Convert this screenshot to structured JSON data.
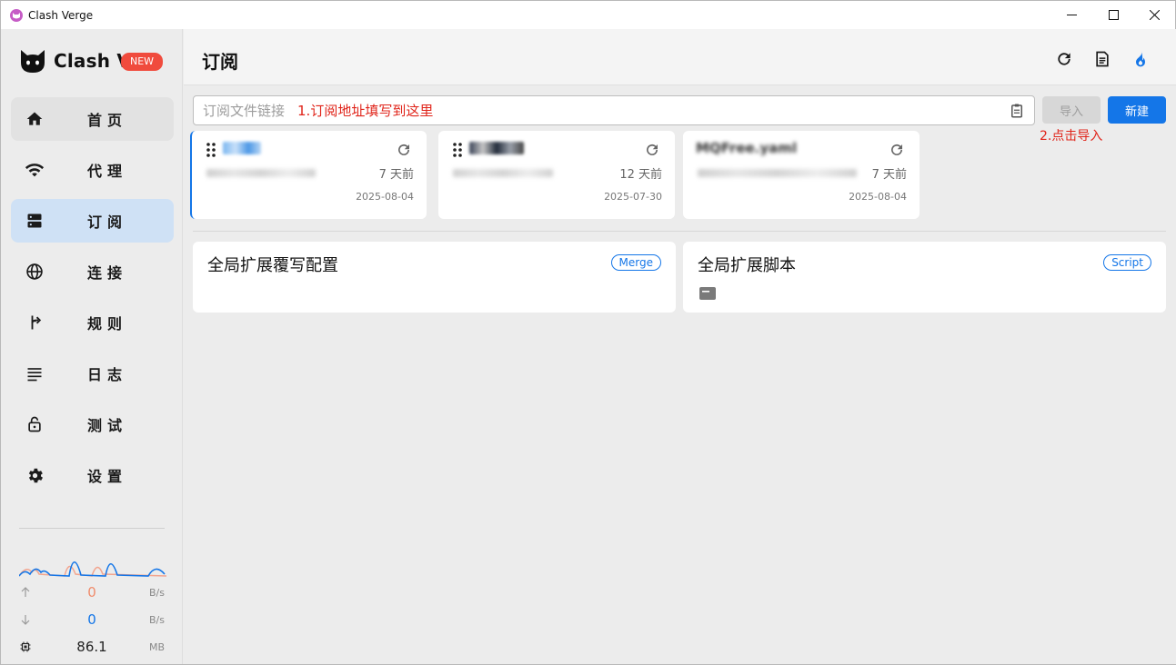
{
  "window": {
    "title": "Clash Verge"
  },
  "sidebar": {
    "brand": "Clash Verge",
    "badge": "NEW",
    "items": [
      {
        "label": "首页",
        "icon": "home-icon"
      },
      {
        "label": "代理",
        "icon": "wifi-icon"
      },
      {
        "label": "订阅",
        "icon": "dns-icon",
        "active": true
      },
      {
        "label": "连接",
        "icon": "globe-icon"
      },
      {
        "label": "规则",
        "icon": "fork-icon"
      },
      {
        "label": "日志",
        "icon": "log-icon"
      },
      {
        "label": "测试",
        "icon": "lock-icon"
      },
      {
        "label": "设置",
        "icon": "gear-icon"
      }
    ],
    "traffic": {
      "up_value": "0",
      "up_unit": "B/s",
      "down_value": "0",
      "down_unit": "B/s",
      "mem_value": "86.1",
      "mem_unit": "MB"
    }
  },
  "header": {
    "title": "订阅"
  },
  "import_bar": {
    "placeholder": "订阅文件链接",
    "hint": "1.订阅地址填写到这里",
    "import_label": "导入",
    "new_label": "新建",
    "hint2": "2.点击导入"
  },
  "subscriptions": [
    {
      "ago": "7 天前",
      "date": "2025-08-04"
    },
    {
      "ago": "12 天前",
      "date": "2025-07-30"
    },
    {
      "name": "MQFree.yaml",
      "ago": "7 天前",
      "date": "2025-08-04"
    }
  ],
  "extensions": [
    {
      "title": "全局扩展覆写配置",
      "tag": "Merge"
    },
    {
      "title": "全局扩展脚本",
      "tag": "Script"
    }
  ],
  "colors": {
    "accent": "#1476e8",
    "hint": "#e0241a",
    "badge": "#f04b3d",
    "active_nav": "#cfe1f5"
  }
}
